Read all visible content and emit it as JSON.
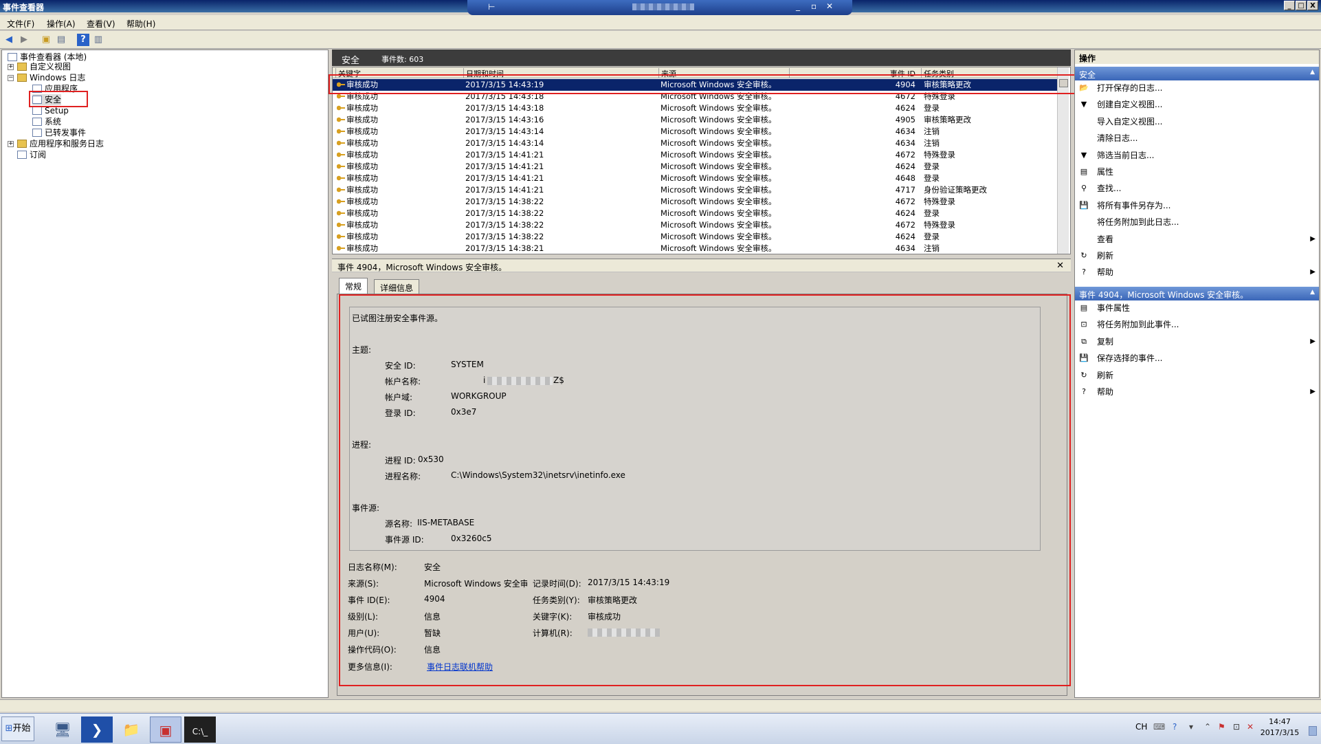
{
  "window": {
    "title": "事件查看器",
    "min": "_",
    "max": "□",
    "close": "X"
  },
  "remote": {
    "pin": "⊢",
    "min": "_",
    "restore": "▫",
    "close": "✕"
  },
  "menu": {
    "file": "文件(F)",
    "action": "操作(A)",
    "view": "查看(V)",
    "help": "帮助(H)"
  },
  "tree": {
    "root": "事件查看器 (本地)",
    "custom_views": "自定义视图",
    "windows_logs": "Windows 日志",
    "application": "应用程序",
    "security": "安全",
    "setup": "Setup",
    "system": "系统",
    "forwarded": "已转发事件",
    "app_service_logs": "应用程序和服务日志",
    "subscriptions": "订阅"
  },
  "list": {
    "log_name": "安全",
    "event_count_label": "事件数: 603",
    "columns": [
      "关键字",
      "日期和时间",
      "来源",
      "事件 ID",
      "任务类别"
    ],
    "rows": [
      {
        "keyword": "审核成功",
        "datetime": "2017/3/15 14:43:19",
        "source": "Microsoft Windows 安全审核。",
        "id": "4904",
        "task": "审核策略更改"
      },
      {
        "keyword": "审核成功",
        "datetime": "2017/3/15 14:43:18",
        "source": "Microsoft Windows 安全审核。",
        "id": "4672",
        "task": "特殊登录"
      },
      {
        "keyword": "审核成功",
        "datetime": "2017/3/15 14:43:18",
        "source": "Microsoft Windows 安全审核。",
        "id": "4624",
        "task": "登录"
      },
      {
        "keyword": "审核成功",
        "datetime": "2017/3/15 14:43:16",
        "source": "Microsoft Windows 安全审核。",
        "id": "4905",
        "task": "审核策略更改"
      },
      {
        "keyword": "审核成功",
        "datetime": "2017/3/15 14:43:14",
        "source": "Microsoft Windows 安全审核。",
        "id": "4634",
        "task": "注销"
      },
      {
        "keyword": "审核成功",
        "datetime": "2017/3/15 14:43:14",
        "source": "Microsoft Windows 安全审核。",
        "id": "4634",
        "task": "注销"
      },
      {
        "keyword": "审核成功",
        "datetime": "2017/3/15 14:41:21",
        "source": "Microsoft Windows 安全审核。",
        "id": "4672",
        "task": "特殊登录"
      },
      {
        "keyword": "审核成功",
        "datetime": "2017/3/15 14:41:21",
        "source": "Microsoft Windows 安全审核。",
        "id": "4624",
        "task": "登录"
      },
      {
        "keyword": "审核成功",
        "datetime": "2017/3/15 14:41:21",
        "source": "Microsoft Windows 安全审核。",
        "id": "4648",
        "task": "登录"
      },
      {
        "keyword": "审核成功",
        "datetime": "2017/3/15 14:41:21",
        "source": "Microsoft Windows 安全审核。",
        "id": "4717",
        "task": "身份验证策略更改"
      },
      {
        "keyword": "审核成功",
        "datetime": "2017/3/15 14:38:22",
        "source": "Microsoft Windows 安全审核。",
        "id": "4672",
        "task": "特殊登录"
      },
      {
        "keyword": "审核成功",
        "datetime": "2017/3/15 14:38:22",
        "source": "Microsoft Windows 安全审核。",
        "id": "4624",
        "task": "登录"
      },
      {
        "keyword": "审核成功",
        "datetime": "2017/3/15 14:38:22",
        "source": "Microsoft Windows 安全审核。",
        "id": "4672",
        "task": "特殊登录"
      },
      {
        "keyword": "审核成功",
        "datetime": "2017/3/15 14:38:22",
        "source": "Microsoft Windows 安全审核。",
        "id": "4624",
        "task": "登录"
      },
      {
        "keyword": "审核成功",
        "datetime": "2017/3/15 14:38:21",
        "source": "Microsoft Windows 安全审核。",
        "id": "4634",
        "task": "注销"
      }
    ]
  },
  "detail": {
    "header": "事件 4904，Microsoft Windows 安全审核。",
    "close": "✕",
    "tab_general": "常规",
    "tab_details": "详细信息",
    "msg": {
      "line1": "已试图注册安全事件源。",
      "subject": "主题:",
      "sid_label": "安全 ID:",
      "sid_value": "SYSTEM",
      "acct_label": "帐户名称:",
      "acct_value_start": "i",
      "acct_value_end": "Z$",
      "domain_label": "帐户域:",
      "domain_value": "WORKGROUP",
      "logon_label": "登录 ID:",
      "logon_value": "0x3e7",
      "process": "进程:",
      "pid_label": "进程 ID:",
      "pid_value": "0x530",
      "pname_label": "进程名称:",
      "pname_value": "C:\\Windows\\System32\\inetsrv\\inetinfo.exe",
      "evsrc": "事件源:",
      "srcname_label": "源名称:",
      "srcname_value": "IIS-METABASE",
      "srcid_label": "事件源 ID:",
      "srcid_value": "0x3260c5"
    },
    "fields": {
      "logname_label": "日志名称(M):",
      "logname_value": "安全",
      "source_label": "来源(S):",
      "source_value": "Microsoft Windows 安全审",
      "logged_label": "记录时间(D):",
      "logged_value": "2017/3/15 14:43:19",
      "eventid_label": "事件 ID(E):",
      "eventid_value": "4904",
      "task_label": "任务类别(Y):",
      "task_value": "审核策略更改",
      "level_label": "级别(L):",
      "level_value": "信息",
      "keywords_label": "关键字(K):",
      "keywords_value": "审核成功",
      "user_label": "用户(U):",
      "user_value": "暂缺",
      "computer_label": "计算机(R):",
      "opcode_label": "操作代码(O):",
      "opcode_value": "信息",
      "moreinfo_label": "更多信息(I):",
      "moreinfo_link": "事件日志联机帮助"
    }
  },
  "actions": {
    "header": "操作",
    "section1": "安全",
    "items1": [
      "打开保存的日志...",
      "创建自定义视图...",
      "导入自定义视图...",
      "清除日志...",
      "筛选当前日志...",
      "属性",
      "查找...",
      "将所有事件另存为...",
      "将任务附加到此日志...",
      "查看",
      "刷新",
      "帮助"
    ],
    "section2": "事件 4904，Microsoft Windows 安全审核。",
    "items2": [
      "事件属性",
      "将任务附加到此事件...",
      "复制",
      "保存选择的事件...",
      "刷新",
      "帮助"
    ]
  },
  "taskbar": {
    "start": "开始",
    "lang": "CH",
    "time": "14:47",
    "date": "2017/3/15"
  },
  "colors": {
    "selection": "#0a246a",
    "highlight_box": "#e02020",
    "section_header": "#3a66b8"
  }
}
